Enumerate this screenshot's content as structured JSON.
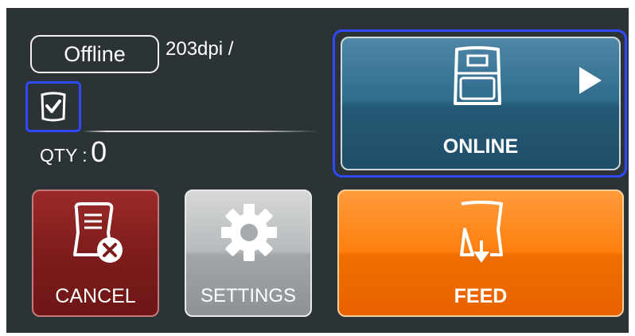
{
  "status": {
    "label": "Offline",
    "resolution": "203dpi /"
  },
  "quantity": {
    "label": "QTY :",
    "value": "0"
  },
  "buttons": {
    "online": "ONLINE",
    "cancel": "CANCEL",
    "settings": "SETTINGS",
    "feed": "FEED"
  },
  "icons": {
    "checkbox": "checkbox-checked-icon",
    "printer": "printer-icon",
    "play": "play-arrow-icon",
    "cancel": "cancel-job-icon",
    "settings": "gear-icon",
    "feed": "paper-feed-icon"
  },
  "colors": {
    "background": "#2b3336",
    "online": "#2f6b8b",
    "cancel": "#7e1c1c",
    "settings": "#b7babc",
    "feed": "#ff7f10",
    "focus": "#2f49ff"
  }
}
